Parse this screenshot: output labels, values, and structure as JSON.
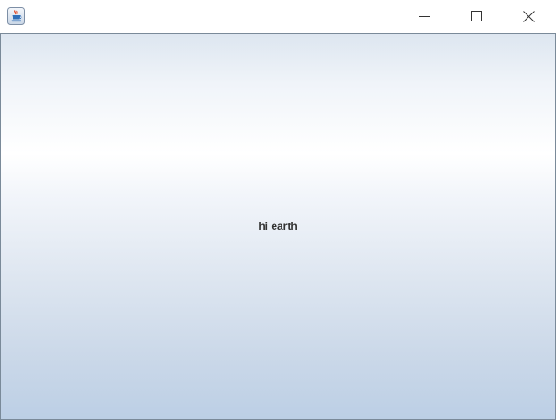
{
  "window": {
    "icon": "java-cup-icon",
    "controls": {
      "minimize_icon": "minimize-icon",
      "maximize_icon": "maximize-icon",
      "close_icon": "close-icon"
    }
  },
  "content": {
    "label": "hi earth",
    "colors": {
      "gradient_top": "#dde6f0",
      "gradient_highlight": "#ffffff",
      "gradient_bottom": "#bccfe5",
      "border": "#7a8a99",
      "text": "#333333"
    }
  }
}
